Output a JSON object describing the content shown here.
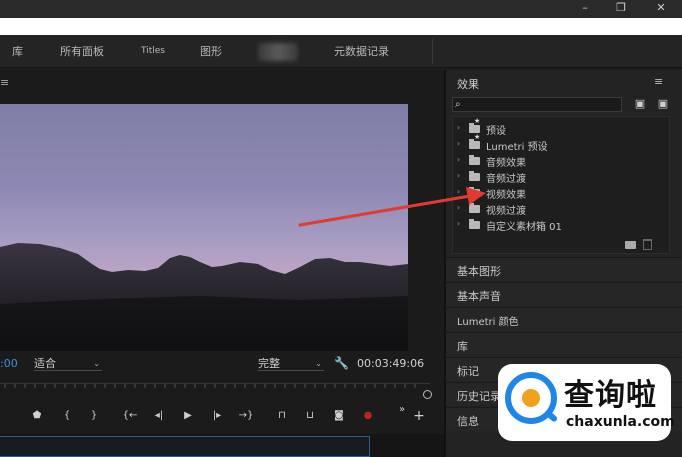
{
  "workspace": {
    "tabs": [
      "库",
      "所有面板",
      "Titles",
      "图形",
      "元数据记录"
    ]
  },
  "window_controls": {
    "minimize": "–",
    "restore": "❐",
    "close": "✕"
  },
  "program_monitor": {
    "menu_icon": "≡",
    "timecode_left": ":00",
    "fit_dropdown": "适合",
    "quality_dropdown": "完整",
    "timecode_right": "00:03:49:06",
    "transport": [
      "marker-icon",
      "in-point-icon",
      "out-point-icon",
      "go-to-in-icon",
      "step-back-icon",
      "play-icon",
      "step-forward-icon",
      "go-to-out-icon",
      "lift-icon",
      "extract-icon",
      "export-frame-icon",
      "record-icon",
      "more-icon",
      "add-icon"
    ]
  },
  "effects_panel": {
    "title": "效果",
    "menu_icon": "≡",
    "search_placeholder": "",
    "tree": [
      {
        "label": "预设",
        "icon": "preset-folder-icon"
      },
      {
        "label": "Lumetri 预设",
        "icon": "preset-folder-icon"
      },
      {
        "label": "音频效果",
        "icon": "folder-icon"
      },
      {
        "label": "音频过渡",
        "icon": "folder-icon"
      },
      {
        "label": "视频效果",
        "icon": "folder-icon"
      },
      {
        "label": "视频过渡",
        "icon": "folder-icon"
      },
      {
        "label": "自定义素材箱 01",
        "icon": "folder-icon"
      }
    ],
    "sections": [
      "基本图形",
      "基本声音",
      "Lumetri 颜色",
      "库",
      "标记",
      "历史记录",
      "信息"
    ]
  },
  "watermark": {
    "title": "查询啦",
    "url": "chaxunla.com"
  },
  "colors": {
    "panel_bg": "#232323",
    "annotation_arrow": "#e03b32",
    "timecode_blue": "#3b8fe0",
    "watermark_blue": "#1f86e8",
    "watermark_orange": "#f0a21d"
  }
}
